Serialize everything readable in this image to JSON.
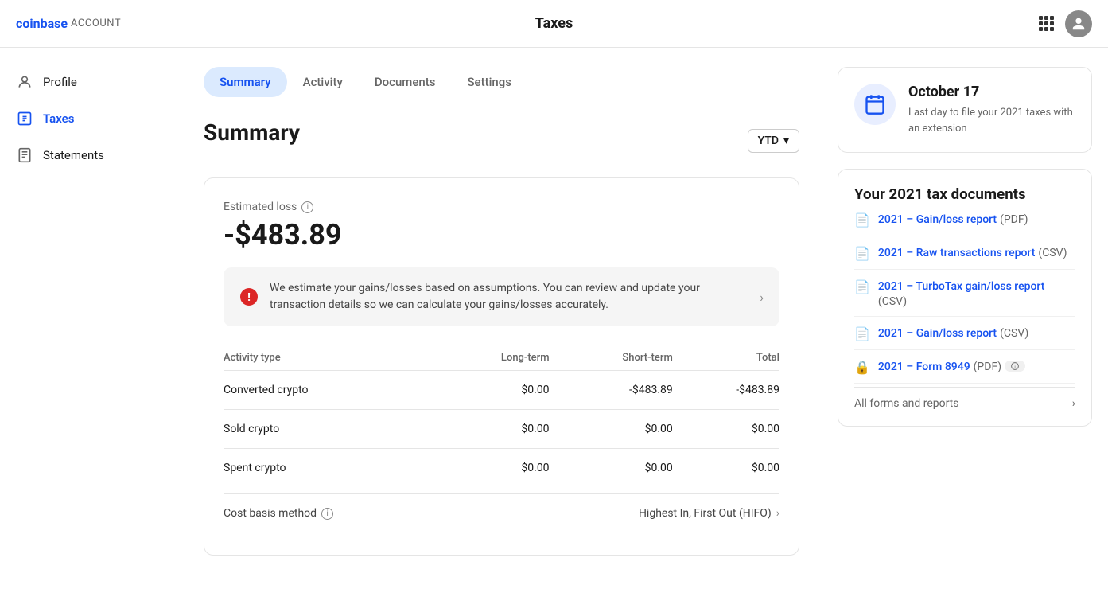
{
  "topbar": {
    "logo_word": "coinbase",
    "account_word": "ACCOUNT",
    "title": "Taxes"
  },
  "sidebar": {
    "items": [
      {
        "id": "profile",
        "label": "Profile",
        "icon": "user-icon",
        "active": false
      },
      {
        "id": "taxes",
        "label": "Taxes",
        "icon": "taxes-icon",
        "active": true
      },
      {
        "id": "statements",
        "label": "Statements",
        "icon": "statements-icon",
        "active": false
      }
    ]
  },
  "tabs": [
    {
      "id": "summary",
      "label": "Summary",
      "active": true
    },
    {
      "id": "activity",
      "label": "Activity",
      "active": false
    },
    {
      "id": "documents",
      "label": "Documents",
      "active": false
    },
    {
      "id": "settings",
      "label": "Settings",
      "active": false
    }
  ],
  "summary": {
    "title": "Summary",
    "period_label": "YTD",
    "estimated_loss_label": "Estimated loss",
    "estimated_amount": "-$483.89",
    "alert_text": "We estimate your gains/losses based on assumptions. You can review and update your transaction details so we can calculate your gains/losses accurately.",
    "table": {
      "columns": [
        "Activity type",
        "Long-term",
        "Short-term",
        "Total"
      ],
      "rows": [
        {
          "type": "Converted crypto",
          "long_term": "$0.00",
          "short_term": "-$483.89",
          "total": "-$483.89"
        },
        {
          "type": "Sold crypto",
          "long_term": "$0.00",
          "short_term": "$0.00",
          "total": "$0.00"
        },
        {
          "type": "Spent crypto",
          "long_term": "$0.00",
          "short_term": "$0.00",
          "total": "$0.00"
        }
      ]
    },
    "cost_basis_label": "Cost basis method",
    "cost_basis_value": "Highest In, First Out (HIFO)"
  },
  "date_card": {
    "date": "October 17",
    "description": "Last day to file your 2021 taxes with an extension"
  },
  "docs_card": {
    "title": "Your 2021 tax documents",
    "documents": [
      {
        "id": "gain-loss-pdf",
        "link": "2021 – Gain/loss report",
        "format": "(PDF)",
        "locked": false
      },
      {
        "id": "raw-transactions-csv",
        "link": "2021 – Raw transactions report",
        "format": "(CSV)",
        "locked": false
      },
      {
        "id": "turbotax-csv",
        "link": "2021 – TurboTax gain/loss report",
        "format": "(CSV)",
        "locked": false
      },
      {
        "id": "gain-loss-csv",
        "link": "2021 – Gain/loss report",
        "format": "(CSV)",
        "locked": false
      },
      {
        "id": "form-8949-pdf",
        "link": "2021 – Form 8949",
        "format": "(PDF)",
        "locked": true
      }
    ],
    "all_reports_label": "All forms and reports"
  }
}
